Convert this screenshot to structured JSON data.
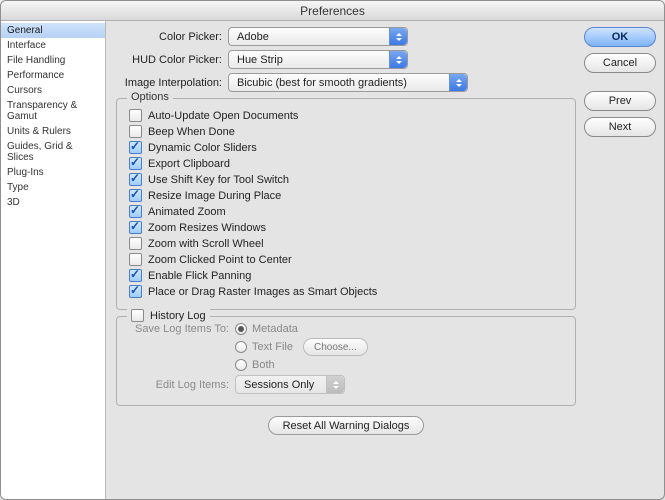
{
  "window": {
    "title": "Preferences"
  },
  "sidebar": {
    "items": [
      {
        "label": "General"
      },
      {
        "label": "Interface"
      },
      {
        "label": "File Handling"
      },
      {
        "label": "Performance"
      },
      {
        "label": "Cursors"
      },
      {
        "label": "Transparency & Gamut"
      },
      {
        "label": "Units & Rulers"
      },
      {
        "label": "Guides, Grid & Slices"
      },
      {
        "label": "Plug-Ins"
      },
      {
        "label": "Type"
      },
      {
        "label": "3D"
      }
    ],
    "selected_index": 0
  },
  "pickers": {
    "color_picker_label": "Color Picker:",
    "color_picker_value": "Adobe",
    "hud_label": "HUD Color Picker:",
    "hud_value": "Hue Strip",
    "interp_label": "Image Interpolation:",
    "interp_value": "Bicubic (best for smooth gradients)"
  },
  "options": {
    "legend": "Options",
    "items": [
      {
        "label": "Auto-Update Open Documents",
        "checked": false
      },
      {
        "label": "Beep When Done",
        "checked": false
      },
      {
        "label": "Dynamic Color Sliders",
        "checked": true
      },
      {
        "label": "Export Clipboard",
        "checked": true
      },
      {
        "label": "Use Shift Key for Tool Switch",
        "checked": true
      },
      {
        "label": "Resize Image During Place",
        "checked": true
      },
      {
        "label": "Animated Zoom",
        "checked": true
      },
      {
        "label": "Zoom Resizes Windows",
        "checked": true
      },
      {
        "label": "Zoom with Scroll Wheel",
        "checked": false
      },
      {
        "label": "Zoom Clicked Point to Center",
        "checked": false
      },
      {
        "label": "Enable Flick Panning",
        "checked": true
      },
      {
        "label": "Place or Drag Raster Images as Smart Objects",
        "checked": true
      }
    ]
  },
  "history": {
    "legend": "History Log",
    "enabled": false,
    "save_to_label": "Save Log Items To:",
    "radios": [
      {
        "label": "Metadata",
        "selected": true
      },
      {
        "label": "Text File",
        "selected": false
      },
      {
        "label": "Both",
        "selected": false
      }
    ],
    "choose_label": "Choose...",
    "edit_label": "Edit Log Items:",
    "edit_value": "Sessions Only"
  },
  "reset_button": "Reset All Warning Dialogs",
  "buttons": {
    "ok": "OK",
    "cancel": "Cancel",
    "prev": "Prev",
    "next": "Next"
  }
}
